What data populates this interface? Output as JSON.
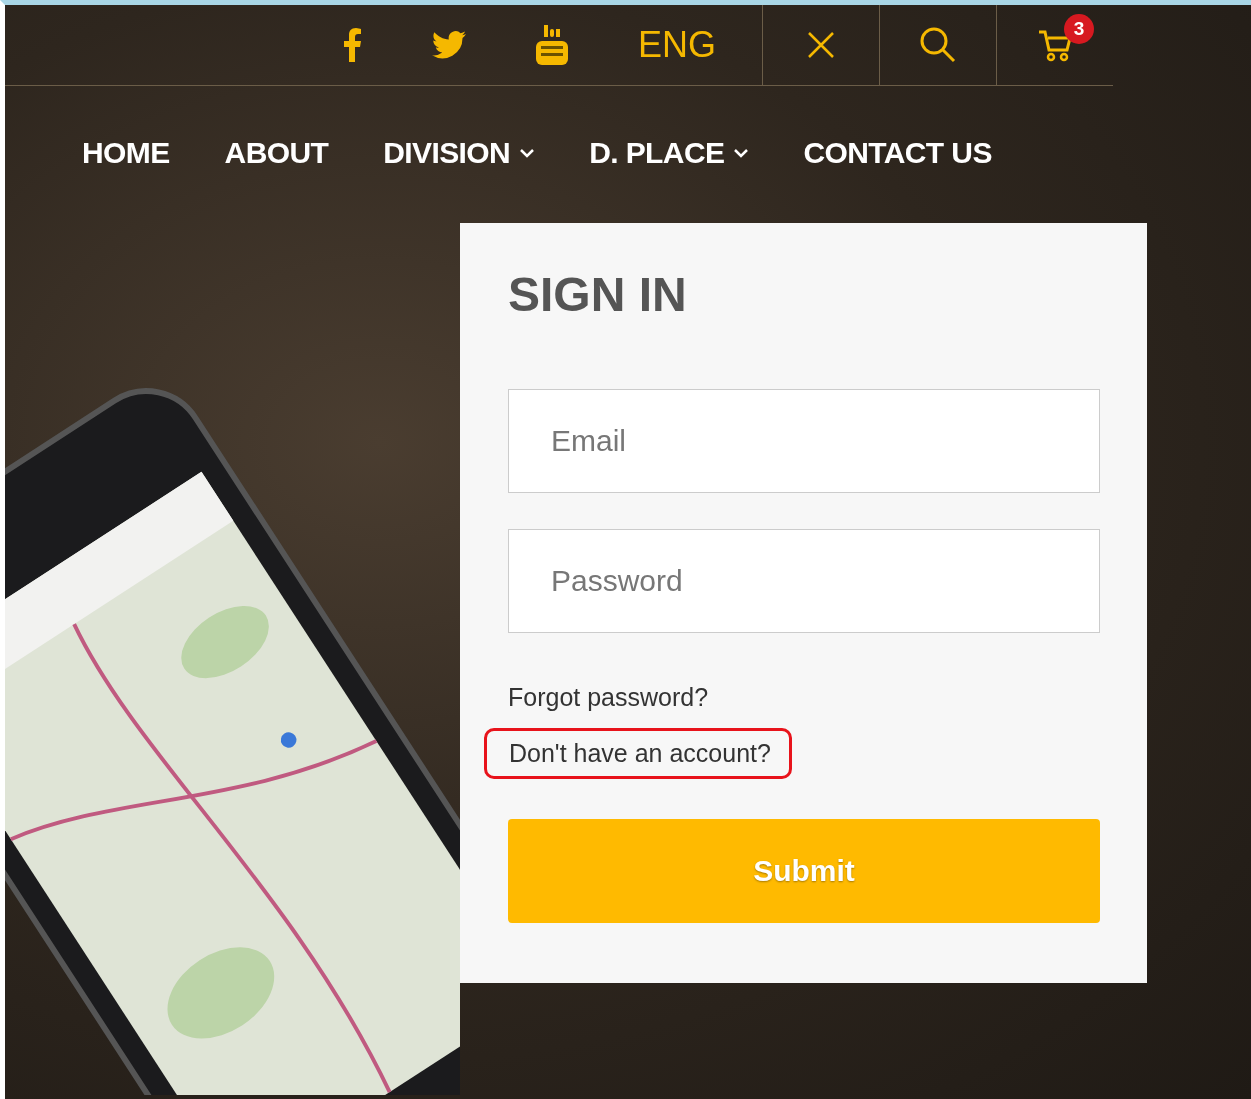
{
  "top_bar": {
    "language": "ENG",
    "cart_count": "3"
  },
  "nav": [
    {
      "label": "HOME",
      "dropdown": false
    },
    {
      "label": "ABOUT",
      "dropdown": false
    },
    {
      "label": "DIVISION",
      "dropdown": true
    },
    {
      "label": "D. PLACE",
      "dropdown": true
    },
    {
      "label": "CONTACT US",
      "dropdown": false
    }
  ],
  "sign_in": {
    "title": "SIGN IN",
    "email": {
      "placeholder": "Email"
    },
    "password": {
      "placeholder": "Password"
    },
    "forgot_link": "Forgot password?",
    "signup_link": "Don't have an account?",
    "signup_highlighted": true,
    "submit": "Submit"
  }
}
